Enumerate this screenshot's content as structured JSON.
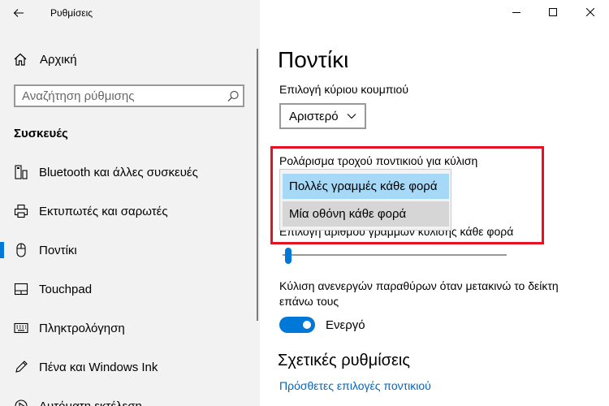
{
  "window": {
    "title": "Ρυθμίσεις",
    "controls": [
      "minimize",
      "maximize",
      "close"
    ]
  },
  "sidebar": {
    "home_label": "Αρχική",
    "search_placeholder": "Αναζήτηση ρύθμισης",
    "section_title": "Συσκευές",
    "items": [
      {
        "label": "Bluetooth και άλλες συσκευές",
        "icon": "bluetooth-icon",
        "selected": false
      },
      {
        "label": "Εκτυπωτές και σαρωτές",
        "icon": "printer-icon",
        "selected": false
      },
      {
        "label": "Ποντίκι",
        "icon": "mouse-icon",
        "selected": true
      },
      {
        "label": "Touchpad",
        "icon": "touchpad-icon",
        "selected": false
      },
      {
        "label": "Πληκτρολόγηση",
        "icon": "keyboard-icon",
        "selected": false
      },
      {
        "label": "Πένα και Windows Ink",
        "icon": "pen-icon",
        "selected": false
      },
      {
        "label": "Αυτόματη εκτέλεση",
        "icon": "autoplay-icon",
        "selected": false
      }
    ]
  },
  "main": {
    "page_title": "Ποντίκι",
    "primary_button_label": "Επιλογή κύριου κουμπιού",
    "primary_button_value": "Αριστερό",
    "scroll_label": "Ρολάρισμα τροχού ποντικιού για κύλιση",
    "scroll_options": [
      "Πολλές γραμμές κάθε φορά",
      "Μία οθόνη κάθε φορά"
    ],
    "scroll_selected_index": 0,
    "lines_label": "Επιλογή αριθμού γραμμών κύλισης κάθε φορά",
    "lines_slider_fraction": 0.01,
    "inactive_scroll_label": "Κύλιση ανενεργών παραθύρων όταν μετακινώ το δείκτη επάνω τους",
    "inactive_scroll_state": "Ενεργό",
    "inactive_scroll_on": true,
    "related_title": "Σχετικές ρυθμίσεις",
    "related_link": "Πρόσθετες επιλογές ποντικιού"
  },
  "colors": {
    "accent": "#0078d7",
    "highlight_box": "#e81123",
    "sidebar_bg": "#f2f2f2",
    "option_selected": "#a6d8f7",
    "option_hover": "#d6d6d6",
    "link": "#0067c0"
  }
}
